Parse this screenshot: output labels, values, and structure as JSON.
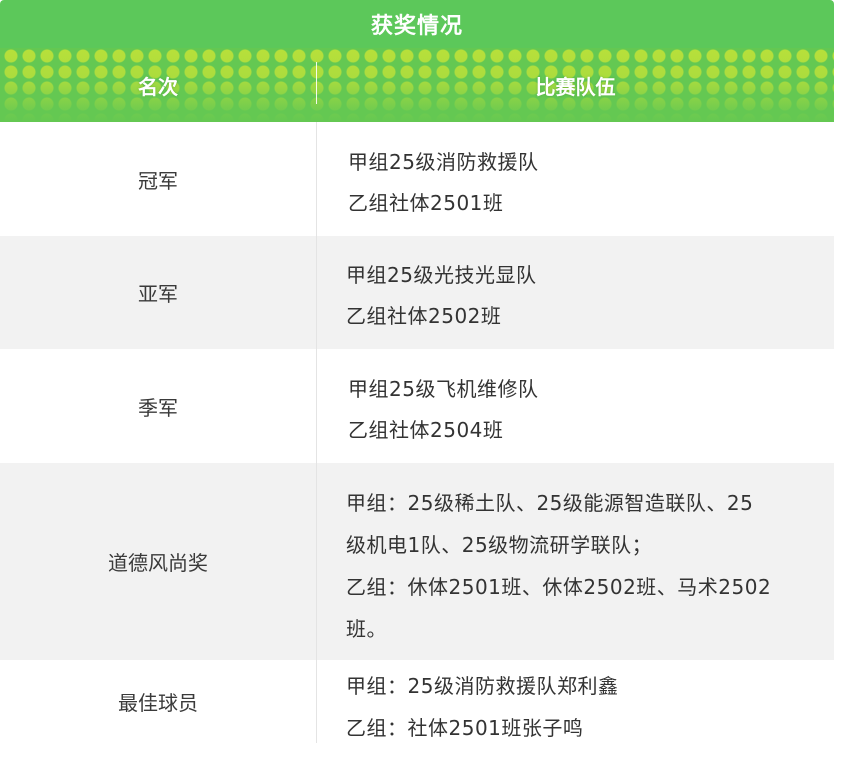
{
  "table": {
    "title": "获奖情况",
    "headers": {
      "rank": "名次",
      "team": "比赛队伍"
    },
    "rows": [
      {
        "rank": "冠军",
        "lines": [
          "甲组25级消防救援队",
          "乙组社体2501班"
        ]
      },
      {
        "rank": "亚军",
        "lines": [
          "甲组25级光技光显队",
          "乙组社体2502班"
        ]
      },
      {
        "rank": "季军",
        "lines": [
          "甲组25级飞机维修队",
          "乙组社体2504班"
        ]
      },
      {
        "rank": "道德风尚奖",
        "lines": [
          "甲组：25级稀土队、25级能源智造联队、25",
          "级机电1队、25级物流研学联队；",
          "乙组：休体2501班、休体2502班、马术2502",
          "班。"
        ]
      },
      {
        "rank": "最佳球员",
        "lines": [
          "甲组：25级消防救援队郑利鑫",
          "乙组：社体2501班张子鸣"
        ]
      }
    ]
  },
  "colors": {
    "title_green": "#5cc85a",
    "header_green": "#64c852",
    "header_dot": "#b8e03a",
    "alt_row": "#f2f2f2",
    "text": "#333333"
  }
}
